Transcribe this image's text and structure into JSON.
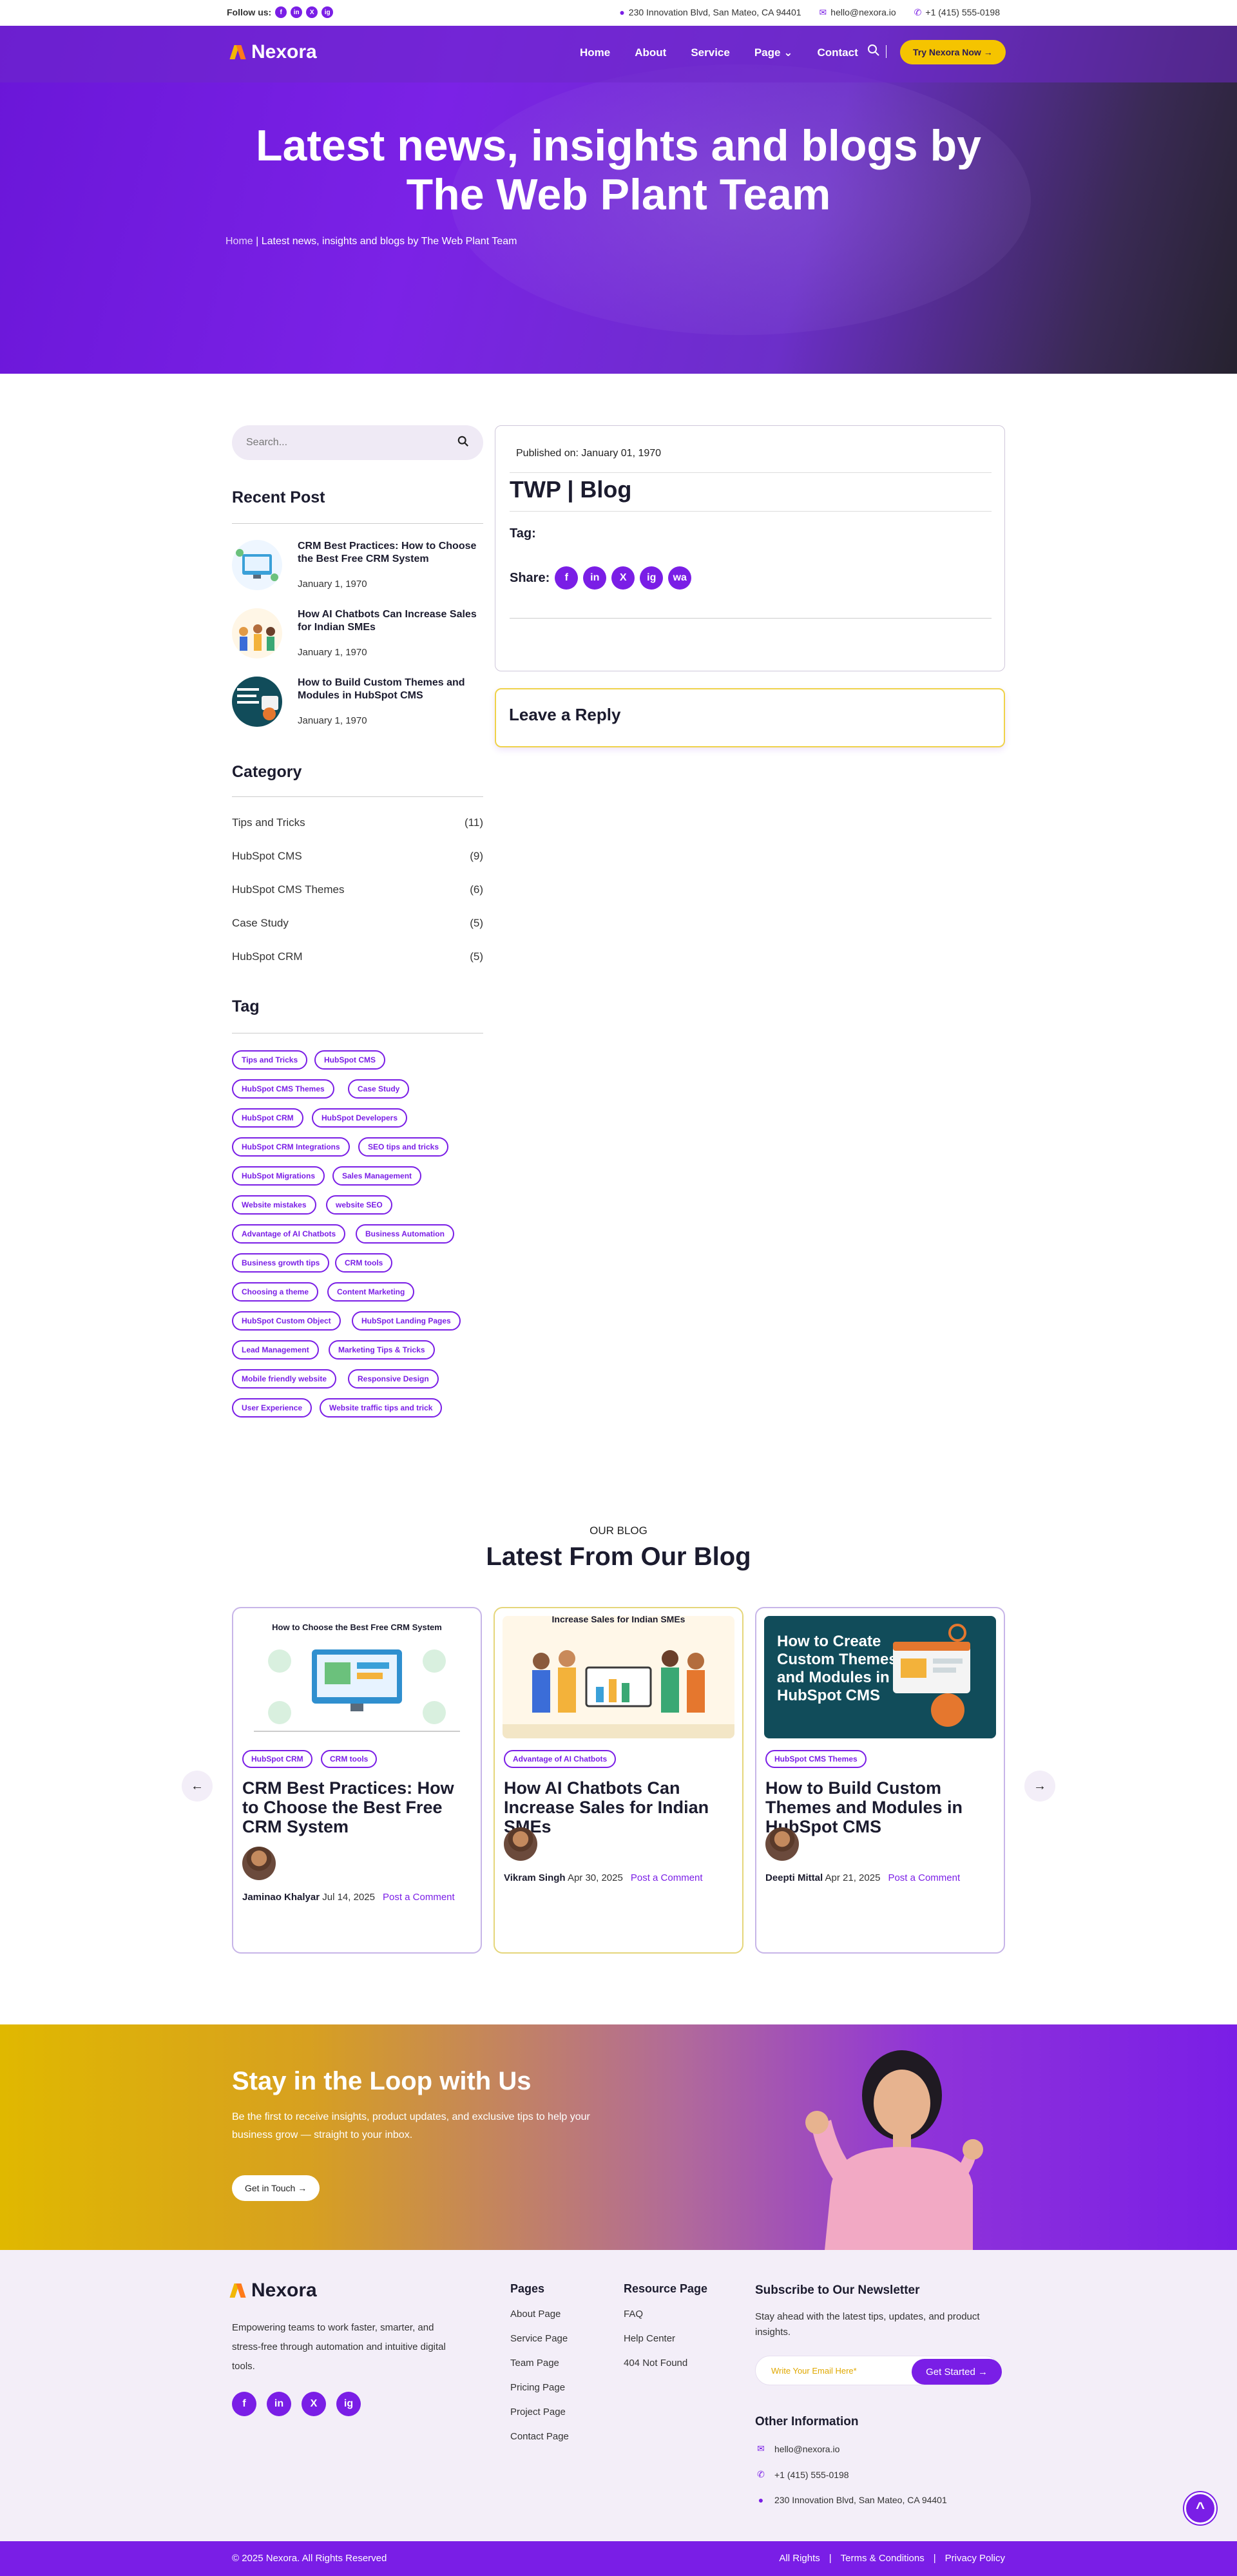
{
  "topbar": {
    "follow_label": "Follow us:",
    "social": [
      "f",
      "in",
      "X",
      "ig"
    ],
    "address": "230 Innovation Blvd, San Mateo, CA 94401",
    "email": "hello@nexora.io",
    "phone": "+1 (415) 555-0198"
  },
  "brand": {
    "name": "Nexora",
    "accent": "#7a1ee6",
    "yellow": "#f5c400"
  },
  "nav": {
    "items": [
      "Home",
      "About",
      "Service",
      "Page",
      "Contact"
    ],
    "page_caret": "⌄",
    "cta": "Try Nexora Now →"
  },
  "hero": {
    "title": "Latest news, insights and blogs by The Web Plant Team",
    "crumb_home": "Home",
    "crumb_sep": "|",
    "crumb_current": "Latest news, insights and blogs by The Web Plant Team"
  },
  "sidebar": {
    "search_placeholder": "Search...",
    "recent_heading": "Recent Post",
    "recent": [
      {
        "title": "CRM Best Practices: How to Choose the Best Free CRM System",
        "date": "January 1, 1970"
      },
      {
        "title": "How AI Chatbots Can Increase Sales for Indian SMEs",
        "date": "January 1, 1970"
      },
      {
        "title": "How to Build Custom Themes and Modules in HubSpot CMS",
        "date": "January 1, 1970"
      }
    ],
    "category_heading": "Category",
    "categories": [
      {
        "name": "Tips and Tricks",
        "count": "(11)"
      },
      {
        "name": "HubSpot CMS",
        "count": "(9)"
      },
      {
        "name": "HubSpot CMS Themes",
        "count": "(6)"
      },
      {
        "name": "Case Study",
        "count": "(5)"
      },
      {
        "name": "HubSpot CRM",
        "count": "(5)"
      }
    ],
    "tag_heading": "Tag",
    "tags": [
      "Tips and Tricks",
      "HubSpot CMS",
      "HubSpot CMS Themes",
      "Case Study",
      "HubSpot CRM",
      "HubSpot Developers",
      "HubSpot CRM Integrations",
      "SEO tips and tricks",
      "HubSpot Migrations",
      "Sales Management",
      "Website mistakes",
      "website SEO",
      "Advantage of AI Chatbots",
      "Business Automation",
      "Business growth tips",
      "CRM tools",
      "Choosing a theme",
      "Content Marketing",
      "HubSpot Custom Object",
      "HubSpot Landing Pages",
      "Lead Management",
      "Marketing Tips & Tricks",
      "Mobile friendly website",
      "Responsive Design",
      "User Experience",
      "Website traffic tips and trick"
    ]
  },
  "post": {
    "published": "Published on: January 01, 1970",
    "title": "TWP | Blog",
    "tag_label": "Tag:",
    "share_label": "Share:",
    "share_icons": [
      "f",
      "in",
      "X",
      "ig",
      "wa"
    ]
  },
  "reply": {
    "heading": "Leave a Reply"
  },
  "blog": {
    "eyebrow": "OUR BLOG",
    "heading": "Latest From Our Blog",
    "prev": "←",
    "next": "→",
    "cards": [
      {
        "img_title": "How to Choose the Best Free CRM System",
        "tags": [
          "HubSpot CRM",
          "CRM tools"
        ],
        "title": "CRM Best Practices: How to Choose the Best Free CRM System",
        "author": "Jaminao Khalyar",
        "date": "Jul 14, 2025",
        "comment": "Post a Comment"
      },
      {
        "img_title": "Increase Sales for Indian SMEs",
        "tags": [
          "Advantage of AI Chatbots"
        ],
        "title": "How AI Chatbots Can Increase Sales for Indian SMEs",
        "author": "Vikram Singh",
        "date": "Apr 30, 2025",
        "comment": "Post a Comment"
      },
      {
        "img_title": "How to Create Custom Themes and Modules in HubSpot CMS",
        "tags": [
          "HubSpot CMS Themes"
        ],
        "title": "How to Build Custom Themes and Modules in HubSpot CMS",
        "author": "Deepti Mittal",
        "date": "Apr 21, 2025",
        "comment": "Post a Comment"
      }
    ]
  },
  "loop": {
    "heading": "Stay in the Loop with Us",
    "text": "Be the first to receive insights, product updates, and exclusive tips to help your business grow — straight to your inbox.",
    "button": "Get in Touch →"
  },
  "footer": {
    "about": "Empowering teams to work faster, smarter, and stress-free through automation and intuitive digital tools.",
    "social": [
      "f",
      "in",
      "X",
      "ig"
    ],
    "pages_heading": "Pages",
    "pages": [
      "About Page",
      "Service Page",
      "Team Page",
      "Pricing Page",
      "Project Page",
      "Contact Page"
    ],
    "resource_heading": "Resource Page",
    "resources": [
      "FAQ",
      "Help Center",
      "404 Not Found"
    ],
    "news_heading": "Subscribe to Our Newsletter",
    "news_text": "Stay ahead with the latest tips, updates, and product insights.",
    "news_placeholder": "Write Your Email Here*",
    "news_button": "Get Started →",
    "other_heading": "Other Information",
    "email": "hello@nexora.io",
    "phone": "+1 (415) 555-0198",
    "address": "230 Innovation Blvd, San Mateo, CA 94401",
    "copyright": "© 2025 Nexora. All Rights Reserved",
    "links": [
      "All Rights",
      "Terms & Conditions",
      "Privacy Policy"
    ],
    "link_sep": "|",
    "to_top": "^"
  }
}
